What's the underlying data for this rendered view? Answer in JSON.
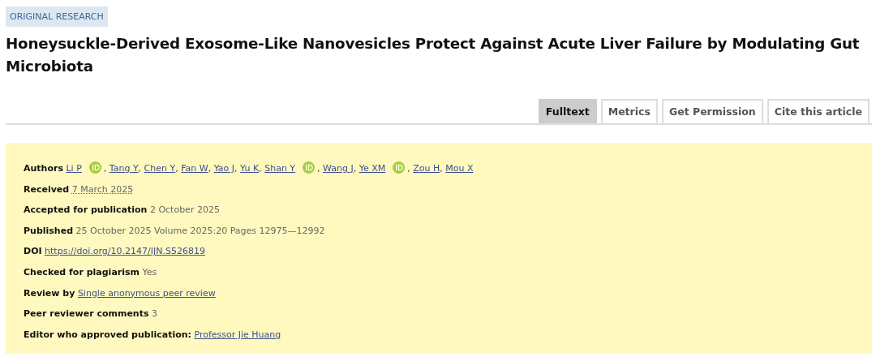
{
  "category": "ORIGINAL RESEARCH",
  "title": "Honeysuckle-Derived Exosome-Like Nanovesicles Protect Against Acute Liver Failure by Modulating Gut Microbiota",
  "tabs": [
    {
      "label": "Fulltext",
      "selected": true
    },
    {
      "label": "Metrics",
      "selected": false
    },
    {
      "label": "Get Permission",
      "selected": false
    },
    {
      "label": "Cite this article",
      "selected": false
    }
  ],
  "authors": {
    "label": "Authors",
    "separator": ",",
    "items": [
      {
        "name": "Li P",
        "orcid": true
      },
      {
        "name": "Tang Y",
        "orcid": false
      },
      {
        "name": "Chen Y",
        "orcid": false
      },
      {
        "name": "Fan W",
        "orcid": false
      },
      {
        "name": "Yao J",
        "orcid": false
      },
      {
        "name": "Yu K",
        "orcid": false
      },
      {
        "name": "Shan Y",
        "orcid": true
      },
      {
        "name": "Wang J",
        "orcid": false
      },
      {
        "name": "Ye XM",
        "orcid": true
      },
      {
        "name": "Zou H",
        "orcid": false
      },
      {
        "name": "Mou X",
        "orcid": false
      }
    ]
  },
  "details": [
    {
      "label": "Received",
      "value": "7 March 2025",
      "kind": "date"
    },
    {
      "label": "Accepted for publication",
      "value": "2 October 2025",
      "kind": "text"
    },
    {
      "label": "Published",
      "value": "25 October 2025 Volume 2025:20 Pages 12975—12992",
      "kind": "text"
    },
    {
      "label": "DOI",
      "value": "https://doi.org/10.2147/IJN.S526819",
      "kind": "link"
    },
    {
      "label": "Checked for plagiarism",
      "value": "Yes",
      "kind": "text"
    },
    {
      "label": "Review by",
      "value": "Single anonymous peer review",
      "kind": "link"
    },
    {
      "label": "Peer reviewer comments",
      "value": "3",
      "kind": "text"
    },
    {
      "label": "Editor who approved publication:",
      "value": "Professor Jie Huang",
      "kind": "link"
    }
  ]
}
